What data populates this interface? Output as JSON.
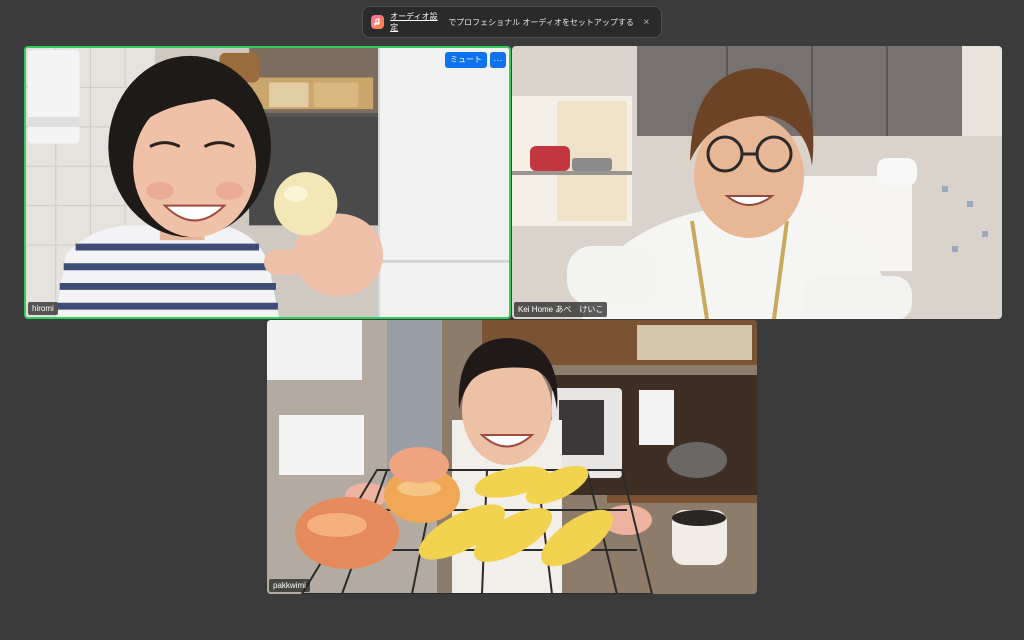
{
  "notification": {
    "icon": "audio-settings-icon",
    "link_label": "オーディオ設定",
    "message": "でプロフェショナル オーディオをセットアップする",
    "close_label": "×"
  },
  "participants": [
    {
      "name": "hiromi",
      "active_speaker": true,
      "mute_label": "ミュート",
      "more_label": "···"
    },
    {
      "name": "Kei Home あべ　けいこ",
      "active_speaker": false
    },
    {
      "name": "pakkwimi",
      "active_speaker": false
    }
  ],
  "colors": {
    "active_speaker_border": "#2fcd5c",
    "button_blue": "#0e72ed",
    "window_background": "#3b3b3b"
  }
}
